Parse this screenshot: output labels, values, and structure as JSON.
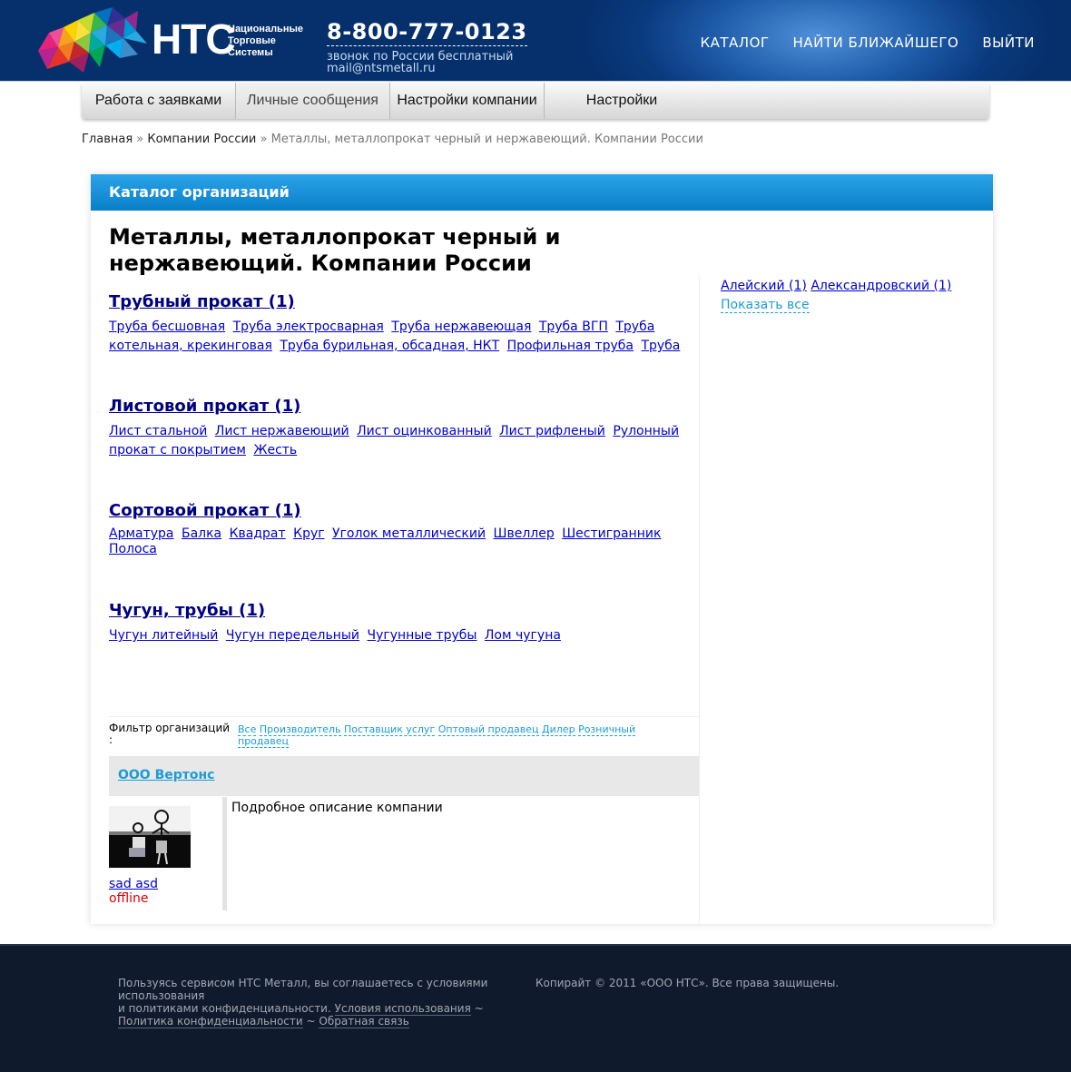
{
  "header": {
    "brand_name": "НТС",
    "brand_subtitle": [
      "Национальные",
      "Торговые",
      "Системы"
    ],
    "phone": "8-800-777-0123",
    "phone_note": "звонок по России бесплатный",
    "email": "mail@ntsmetall.ru",
    "nav": [
      "КАТАЛОГ",
      "НАЙТИ БЛИЖАЙШЕГО",
      "ВЫЙТИ"
    ]
  },
  "tabs": [
    "Работа с заявками",
    "Личные сообщения",
    "Настройки компании",
    "Настройки"
  ],
  "breadcrumb": {
    "items": [
      "Главная",
      "Компании России"
    ],
    "separator": "»",
    "current": "Металлы, металлопрокат черный и нержавеющий. Компании России"
  },
  "panel": {
    "header": "Каталог организаций",
    "title": "Металлы, металлопрокат черный и нержавеющий. Компании России"
  },
  "categories": [
    {
      "title": "Трубный прокат (1)",
      "links": [
        "Труба бесшовная",
        "Труба электросварная",
        "Труба нержавеющая",
        "Труба ВГП",
        "Труба котельная, крекинговая",
        "Труба бурильная, обсадная, НКТ",
        "Профильная труба",
        "Труба"
      ]
    },
    {
      "title": "Листовой прокат (1)",
      "links": [
        "Лист стальной",
        "Лист нержавеющий",
        "Лист оцинкованный",
        "Лист рифленый",
        "Рулонный прокат с покрытием",
        "Жесть"
      ]
    },
    {
      "title": "Сортовой прокат (1)",
      "links": [
        "Арматура",
        "Балка",
        "Квадрат",
        "Круг",
        "Уголок металлический",
        "Швеллер",
        "Шестигранник",
        "Полоса"
      ]
    },
    {
      "title": "Чугун, трубы (1)",
      "links": [
        "Чугун литейный",
        "Чугун передельный",
        "Чугунные трубы",
        "Лом чугуна"
      ]
    }
  ],
  "cities": {
    "items": [
      "Алейский (1)",
      "Александровский (1)"
    ],
    "show_all": "Показать все"
  },
  "filter": {
    "label": "Фильтр организаций :",
    "options": [
      "Все",
      "Производитель",
      "Поставщик услуг",
      "Оптовый продавец",
      "Дилер",
      "Розничный продавец"
    ]
  },
  "organization": {
    "name": "ООО Вертонс",
    "user": "sad asd",
    "status": "offline",
    "description": "Подробное описание компании"
  },
  "footer": {
    "terms_text_1": "Пользуясь сервисом НТС Металл, вы соглашаетесь с условиями использования",
    "terms_text_2": "и политиками конфиденциальности.",
    "links": [
      "Условия использования",
      "Политика конфиденциальности",
      "Обратная связь"
    ],
    "link_separator": "~",
    "copyright": "Копирайт © 2011 «ООО НТС». Все права защищены."
  },
  "colors": {
    "header_bg": "#0a3a7e",
    "panel_header": "#0a7fc8",
    "link": "#0000cc",
    "category_title": "#000080",
    "accent_link": "#1c9bd6",
    "offline": "#dd0000",
    "footer_bg": "#101a2d"
  }
}
